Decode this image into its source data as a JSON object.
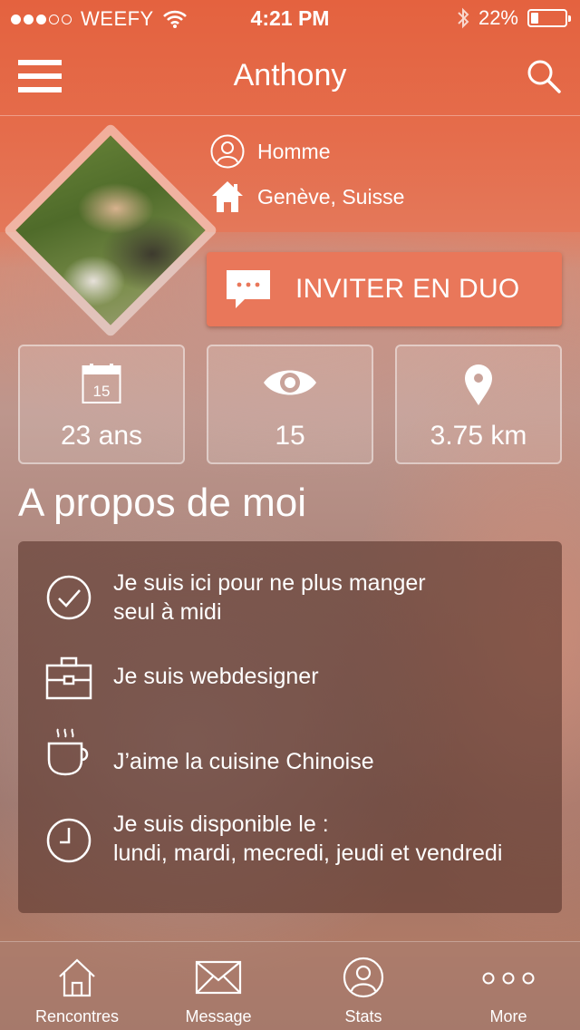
{
  "status_bar": {
    "carrier": "WEEFY",
    "time": "4:21 PM",
    "battery": "22%",
    "battery_level": 0.22,
    "signal_bars_filled": 3,
    "signal_bars_total": 5
  },
  "nav": {
    "title": "Anthony",
    "menu_icon": "hamburger-icon",
    "search_icon": "search-icon"
  },
  "profile": {
    "gender": "Homme",
    "location": "Genève, Suisse",
    "gender_icon": "person-icon",
    "location_icon": "home-icon"
  },
  "invite_button": {
    "label": "INVITER EN DUO",
    "icon": "chat-bubble-icon"
  },
  "stats": {
    "age": {
      "value": "23 ans",
      "icon_day": "15",
      "icon": "calendar-icon"
    },
    "views": {
      "value": "15",
      "icon": "eye-icon"
    },
    "distance": {
      "value": "3.75 km",
      "icon": "map-pin-icon"
    }
  },
  "about": {
    "title": "A propos de moi",
    "items": [
      {
        "line1": "Je suis ici pour ne plus manger",
        "line2": "seul à midi",
        "icon": "check-circle-icon"
      },
      {
        "line1": "Je suis webdesigner",
        "line2": "",
        "icon": "briefcase-icon"
      },
      {
        "line1": "J’aime la cuisine Chinoise",
        "line2": "",
        "icon": "coffee-cup-icon"
      },
      {
        "line1": "Je suis disponible le :",
        "line2": "lundi, mardi, mecredi, jeudi et vendredi",
        "icon": "clock-icon"
      }
    ]
  },
  "tabs": [
    {
      "label": "Rencontres",
      "icon": "house-icon"
    },
    {
      "label": "Message",
      "icon": "envelope-icon"
    },
    {
      "label": "Stats",
      "icon": "user-circle-icon"
    },
    {
      "label": "More",
      "icon": "more-dots-icon"
    }
  ],
  "colors": {
    "accent": "#e46a48",
    "button": "#e9775a",
    "panel": "#5c372d"
  }
}
